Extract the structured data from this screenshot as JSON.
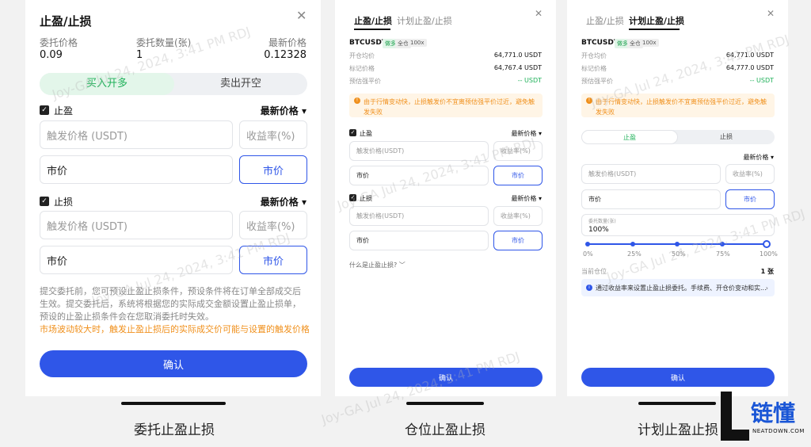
{
  "watermark": "Joy-GA Jul 24, 2024, 3:41 PM RDJ",
  "panel1": {
    "title": "止盈/止损",
    "cols": [
      {
        "label": "委托价格",
        "value": "0.09"
      },
      {
        "label": "委托数量(张)",
        "value": "1"
      },
      {
        "label": "最新价格",
        "value": "0.12328"
      }
    ],
    "seg": {
      "on": "买入开多",
      "off": "卖出开空"
    },
    "tp": {
      "label": "止盈",
      "dropdown": "最新价格 ▾",
      "trigger_placeholder": "触发价格 (USDT)",
      "rate": "收益率(%)",
      "price": "市价",
      "button": "市价"
    },
    "sl": {
      "label": "止损",
      "dropdown": "最新价格 ▾",
      "trigger_placeholder": "触发价格 (USDT)",
      "rate": "收益率(%)",
      "price": "市价",
      "button": "市价"
    },
    "note1": "提交委托前，您可预设止盈止损条件，预设条件将在订单全部成交后生效。提交委托后，系统将根据您的实际成交金额设置止盈止损单，预设的止盈止损条件会在您取消委托时失效。",
    "note2": "市场波动较大时，触发止盈止损后的实际成交价可能与设置的触发价格有所",
    "confirm": "确认",
    "caption": "委托止盈止损"
  },
  "panel2": {
    "tabs": [
      "止盈/止损",
      "计划止盈/止损"
    ],
    "symbol": "BTCUSDT",
    "tags": [
      "做多",
      "全仓",
      "100x"
    ],
    "rows": [
      {
        "label": "开仓均价",
        "value": "64,771.0 USDT"
      },
      {
        "label": "标记价格",
        "value": "64,767.4 USDT"
      },
      {
        "label": "预估强平价",
        "value": "-- USDT"
      }
    ],
    "warn": "由于行情变动快，止损触发价不宜离预估强平价过近，避免触发失败",
    "tp": {
      "label": "止盈",
      "dropdown": "最新价格 ▾",
      "trigger": "触发价格(USDT)",
      "rate": "收益率(%)",
      "price": "市价",
      "button": "市价"
    },
    "sl": {
      "label": "止损",
      "dropdown": "最新价格 ▾",
      "trigger": "触发价格(USDT)",
      "rate": "收益率(%)",
      "price": "市价",
      "button": "市价"
    },
    "what": "什么是止盈止损?  ﹀",
    "confirm": "确认",
    "caption": "仓位止盈止损"
  },
  "panel3": {
    "tabs": [
      "止盈/止损",
      "计划止盈/止损"
    ],
    "symbol": "BTCUSDT",
    "tags": [
      "做多",
      "全仓",
      "100x"
    ],
    "rows": [
      {
        "label": "开仓均价",
        "value": "64,771.0 USDT"
      },
      {
        "label": "标记价格",
        "value": "64,777.0 USDT"
      },
      {
        "label": "预估强平价",
        "value": "-- USDT"
      }
    ],
    "warn": "由于行情变动快，止损触发价不宜离预估强平价过近，避免触发失败",
    "seg": {
      "on": "止盈",
      "off": "止损"
    },
    "dropdown": "最新价格 ▾",
    "trigger": "触发价格(USDT)",
    "rate": "收益率(%)",
    "price": "市价",
    "button": "市价",
    "qty_label": "委托数量(张)",
    "qty_value": "100%",
    "ticks": [
      "0%",
      "25%",
      "50%",
      "75%",
      "100%"
    ],
    "slider_fraction": 1.0,
    "position_label": "当前仓位",
    "position_value": "1 张",
    "info": "通过收益率来设置止盈止损委托。手续费、开仓价变动和实...",
    "confirm": "确认",
    "caption": "计划止盈止损"
  },
  "logo": {
    "text": "链懂",
    "sub": "NEATDOWN.COM",
    "color": "#1a56d6"
  }
}
